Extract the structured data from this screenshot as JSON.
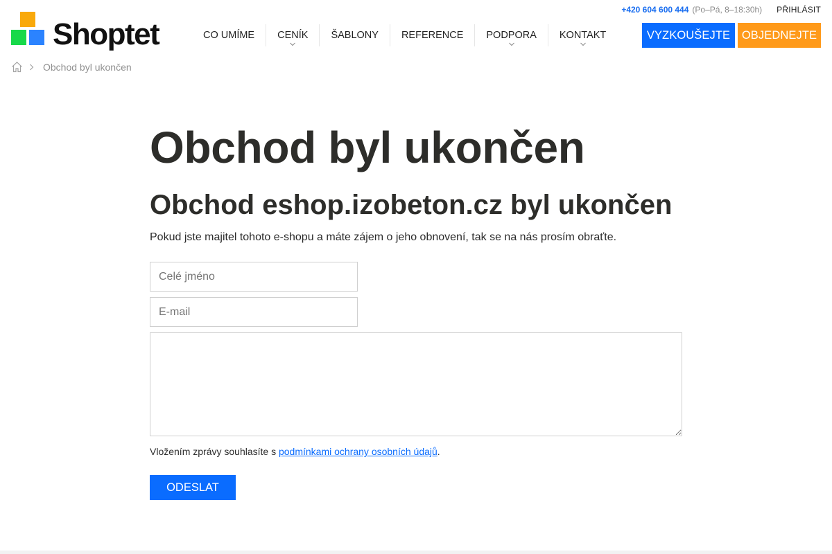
{
  "header": {
    "logo_text": "Shoptet",
    "logo_colors": {
      "orange": "#f9a90b",
      "green": "#17d94a",
      "blue": "#2b83ff"
    },
    "phone": "+420 604 600 444",
    "hours": "(Po–Pá, 8–18:30h)",
    "login_label": "PŘIHLÁSIT",
    "nav": [
      {
        "label": "CO UMÍME",
        "has_dropdown": false
      },
      {
        "label": "CENÍK",
        "has_dropdown": true
      },
      {
        "label": "ŠABLONY",
        "has_dropdown": false
      },
      {
        "label": "REFERENCE",
        "has_dropdown": false
      },
      {
        "label": "PODPORA",
        "has_dropdown": true
      },
      {
        "label": "KONTAKT",
        "has_dropdown": true
      }
    ],
    "cta_try": "VYZKOUŠEJTE",
    "cta_order": "OBJEDNEJTE",
    "accent_blue": "#0a6cff",
    "accent_orange": "#ff9a1a"
  },
  "breadcrumb": {
    "home_icon": "home-icon",
    "current": "Obchod byl ukončen"
  },
  "main": {
    "title": "Obchod byl ukončen",
    "subtitle": "Obchod eshop.izobeton.cz byl ukončen",
    "lead": "Pokud jste majitel tohoto e-shopu a máte zájem o jeho obnovení, tak se na nás prosím obraťte.",
    "form": {
      "name_placeholder": "Celé jméno",
      "name_value": "",
      "email_placeholder": "E-mail",
      "email_value": "",
      "message_value": "",
      "consent_prefix": "Vložením zprávy souhlasíte s ",
      "consent_link": "podmínkami ochrany osobních údajů",
      "consent_suffix": ".",
      "submit_label": "ODESLAT"
    }
  }
}
